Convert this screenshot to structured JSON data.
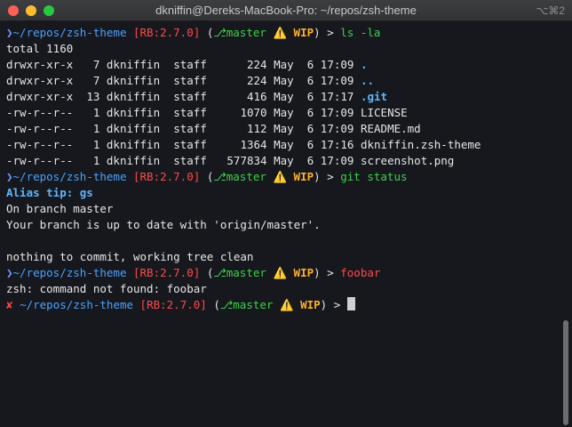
{
  "titlebar": {
    "title": "dkniffin@Dereks-MacBook-Pro: ~/repos/zsh-theme",
    "shortcut": "⌥⌘2"
  },
  "prompt": {
    "path": "~/repos/zsh-theme",
    "rb_open": "[",
    "rb_label": "RB:2.7.0",
    "rb_close": "]",
    "paren_open": "(",
    "branch_glyph": "⎇",
    "branch": "master",
    "warn_glyph": "⚠️",
    "wip": "WIP",
    "paren_close": ")",
    "arrow": ">",
    "start_glyph": "❯",
    "error_glyph": "✘"
  },
  "commands": {
    "ls": "ls -la",
    "git": "git status",
    "foobar": "foobar"
  },
  "ls_output": {
    "total": "total 1160",
    "rows": [
      {
        "perm": "drwxr-xr-x",
        "links": "7",
        "owner": "dkniffin",
        "group": "staff",
        "size": "224",
        "month": "May",
        "day": "6",
        "time": "17:09",
        "name": ".",
        "is_dir": true
      },
      {
        "perm": "drwxr-xr-x",
        "links": "7",
        "owner": "dkniffin",
        "group": "staff",
        "size": "224",
        "month": "May",
        "day": "6",
        "time": "17:09",
        "name": "..",
        "is_dir": true
      },
      {
        "perm": "drwxr-xr-x",
        "links": "13",
        "owner": "dkniffin",
        "group": "staff",
        "size": "416",
        "month": "May",
        "day": "6",
        "time": "17:17",
        "name": ".git",
        "is_dir": true
      },
      {
        "perm": "-rw-r--r--",
        "links": "1",
        "owner": "dkniffin",
        "group": "staff",
        "size": "1070",
        "month": "May",
        "day": "6",
        "time": "17:09",
        "name": "LICENSE",
        "is_dir": false
      },
      {
        "perm": "-rw-r--r--",
        "links": "1",
        "owner": "dkniffin",
        "group": "staff",
        "size": "112",
        "month": "May",
        "day": "6",
        "time": "17:09",
        "name": "README.md",
        "is_dir": false
      },
      {
        "perm": "-rw-r--r--",
        "links": "1",
        "owner": "dkniffin",
        "group": "staff",
        "size": "1364",
        "month": "May",
        "day": "6",
        "time": "17:16",
        "name": "dkniffin.zsh-theme",
        "is_dir": false
      },
      {
        "perm": "-rw-r--r--",
        "links": "1",
        "owner": "dkniffin",
        "group": "staff",
        "size": "577834",
        "month": "May",
        "day": "6",
        "time": "17:09",
        "name": "screenshot.png",
        "is_dir": false
      }
    ]
  },
  "git_output": {
    "alias_tip": "Alias tip: gs",
    "lines": [
      "On branch master",
      "Your branch is up to date with 'origin/master'.",
      "",
      "nothing to commit, working tree clean"
    ]
  },
  "foobar_output": "zsh: command not found: foobar"
}
